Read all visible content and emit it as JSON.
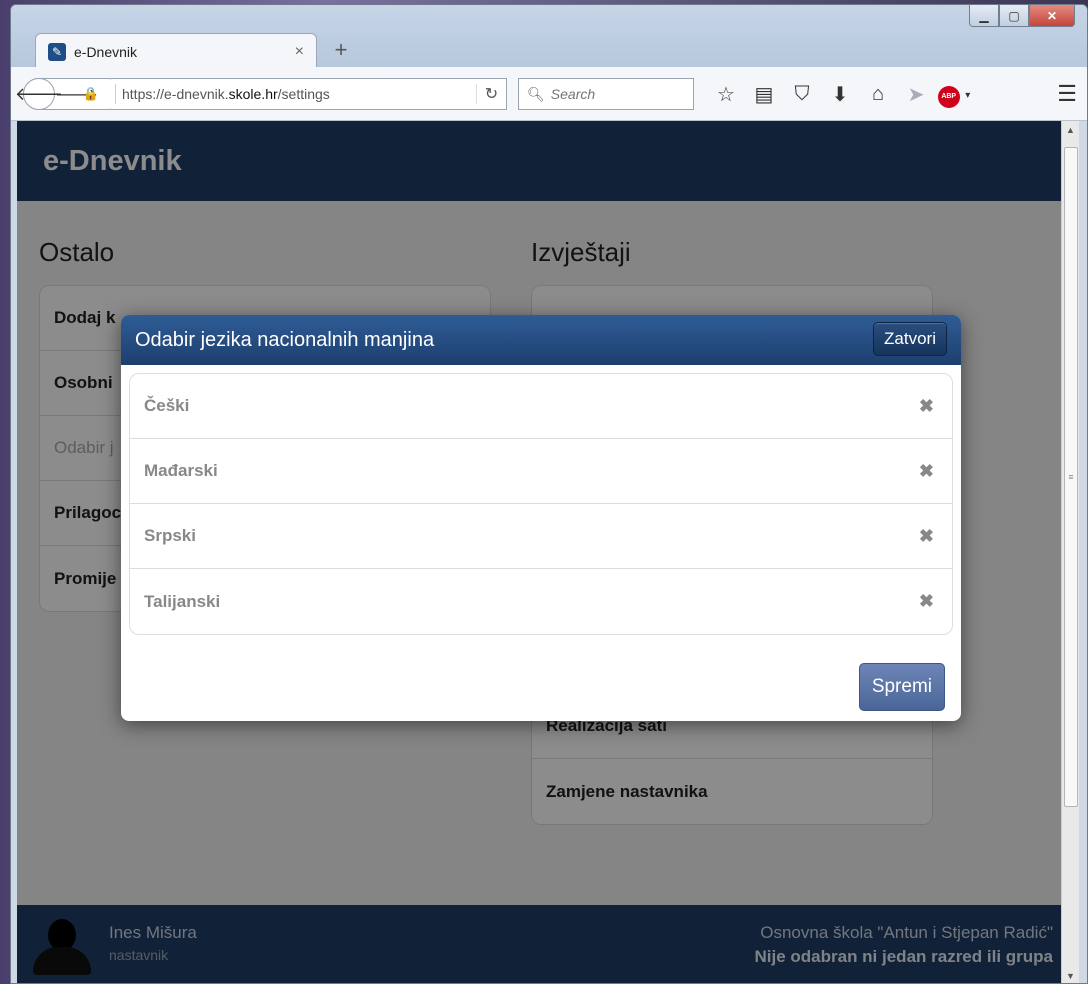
{
  "browser": {
    "tab_title": "e-Dnevnik",
    "tab_close": "×",
    "new_tab": "+",
    "url_prefix": "https://e-dnevnik.",
    "url_domain": "skole.hr",
    "url_path": "/settings",
    "search_placeholder": "Search",
    "icons": [
      "star-icon",
      "reading-list-icon",
      "pocket-icon",
      "download-icon",
      "home-icon",
      "share-icon",
      "adblock-icon",
      "hamburger-menu-icon"
    ],
    "abp_label": "ABP"
  },
  "app": {
    "brand": "e-Dnevnik",
    "header_color": "#1f3c66"
  },
  "left_column": {
    "title": "Ostalo",
    "items": [
      {
        "label": "Dodaj k",
        "disabled": false
      },
      {
        "label": "Osobni",
        "disabled": false
      },
      {
        "label": "Odabir j",
        "disabled": true
      },
      {
        "label": "Prilagoc",
        "disabled": false
      },
      {
        "label": "Promije",
        "disabled": false
      }
    ]
  },
  "right_column": {
    "title": "Izvještaji",
    "items": [
      {
        "label": "Realizacija sati"
      },
      {
        "label": "Zamjene nastavnika"
      }
    ]
  },
  "footer": {
    "user_name": "Ines Mišura",
    "user_role": "nastavnik",
    "school": "Osnovna škola \"Antun i Stjepan Radić\"",
    "status": "Nije odabran ni jedan razred ili grupa"
  },
  "modal": {
    "title": "Odabir jezika nacionalnih manjina",
    "close_label": "Zatvori",
    "save_label": "Spremi",
    "languages": [
      {
        "name": "Češki"
      },
      {
        "name": "Mađarski"
      },
      {
        "name": "Srpski"
      },
      {
        "name": "Talijanski"
      }
    ],
    "remove_glyph": "✖"
  }
}
